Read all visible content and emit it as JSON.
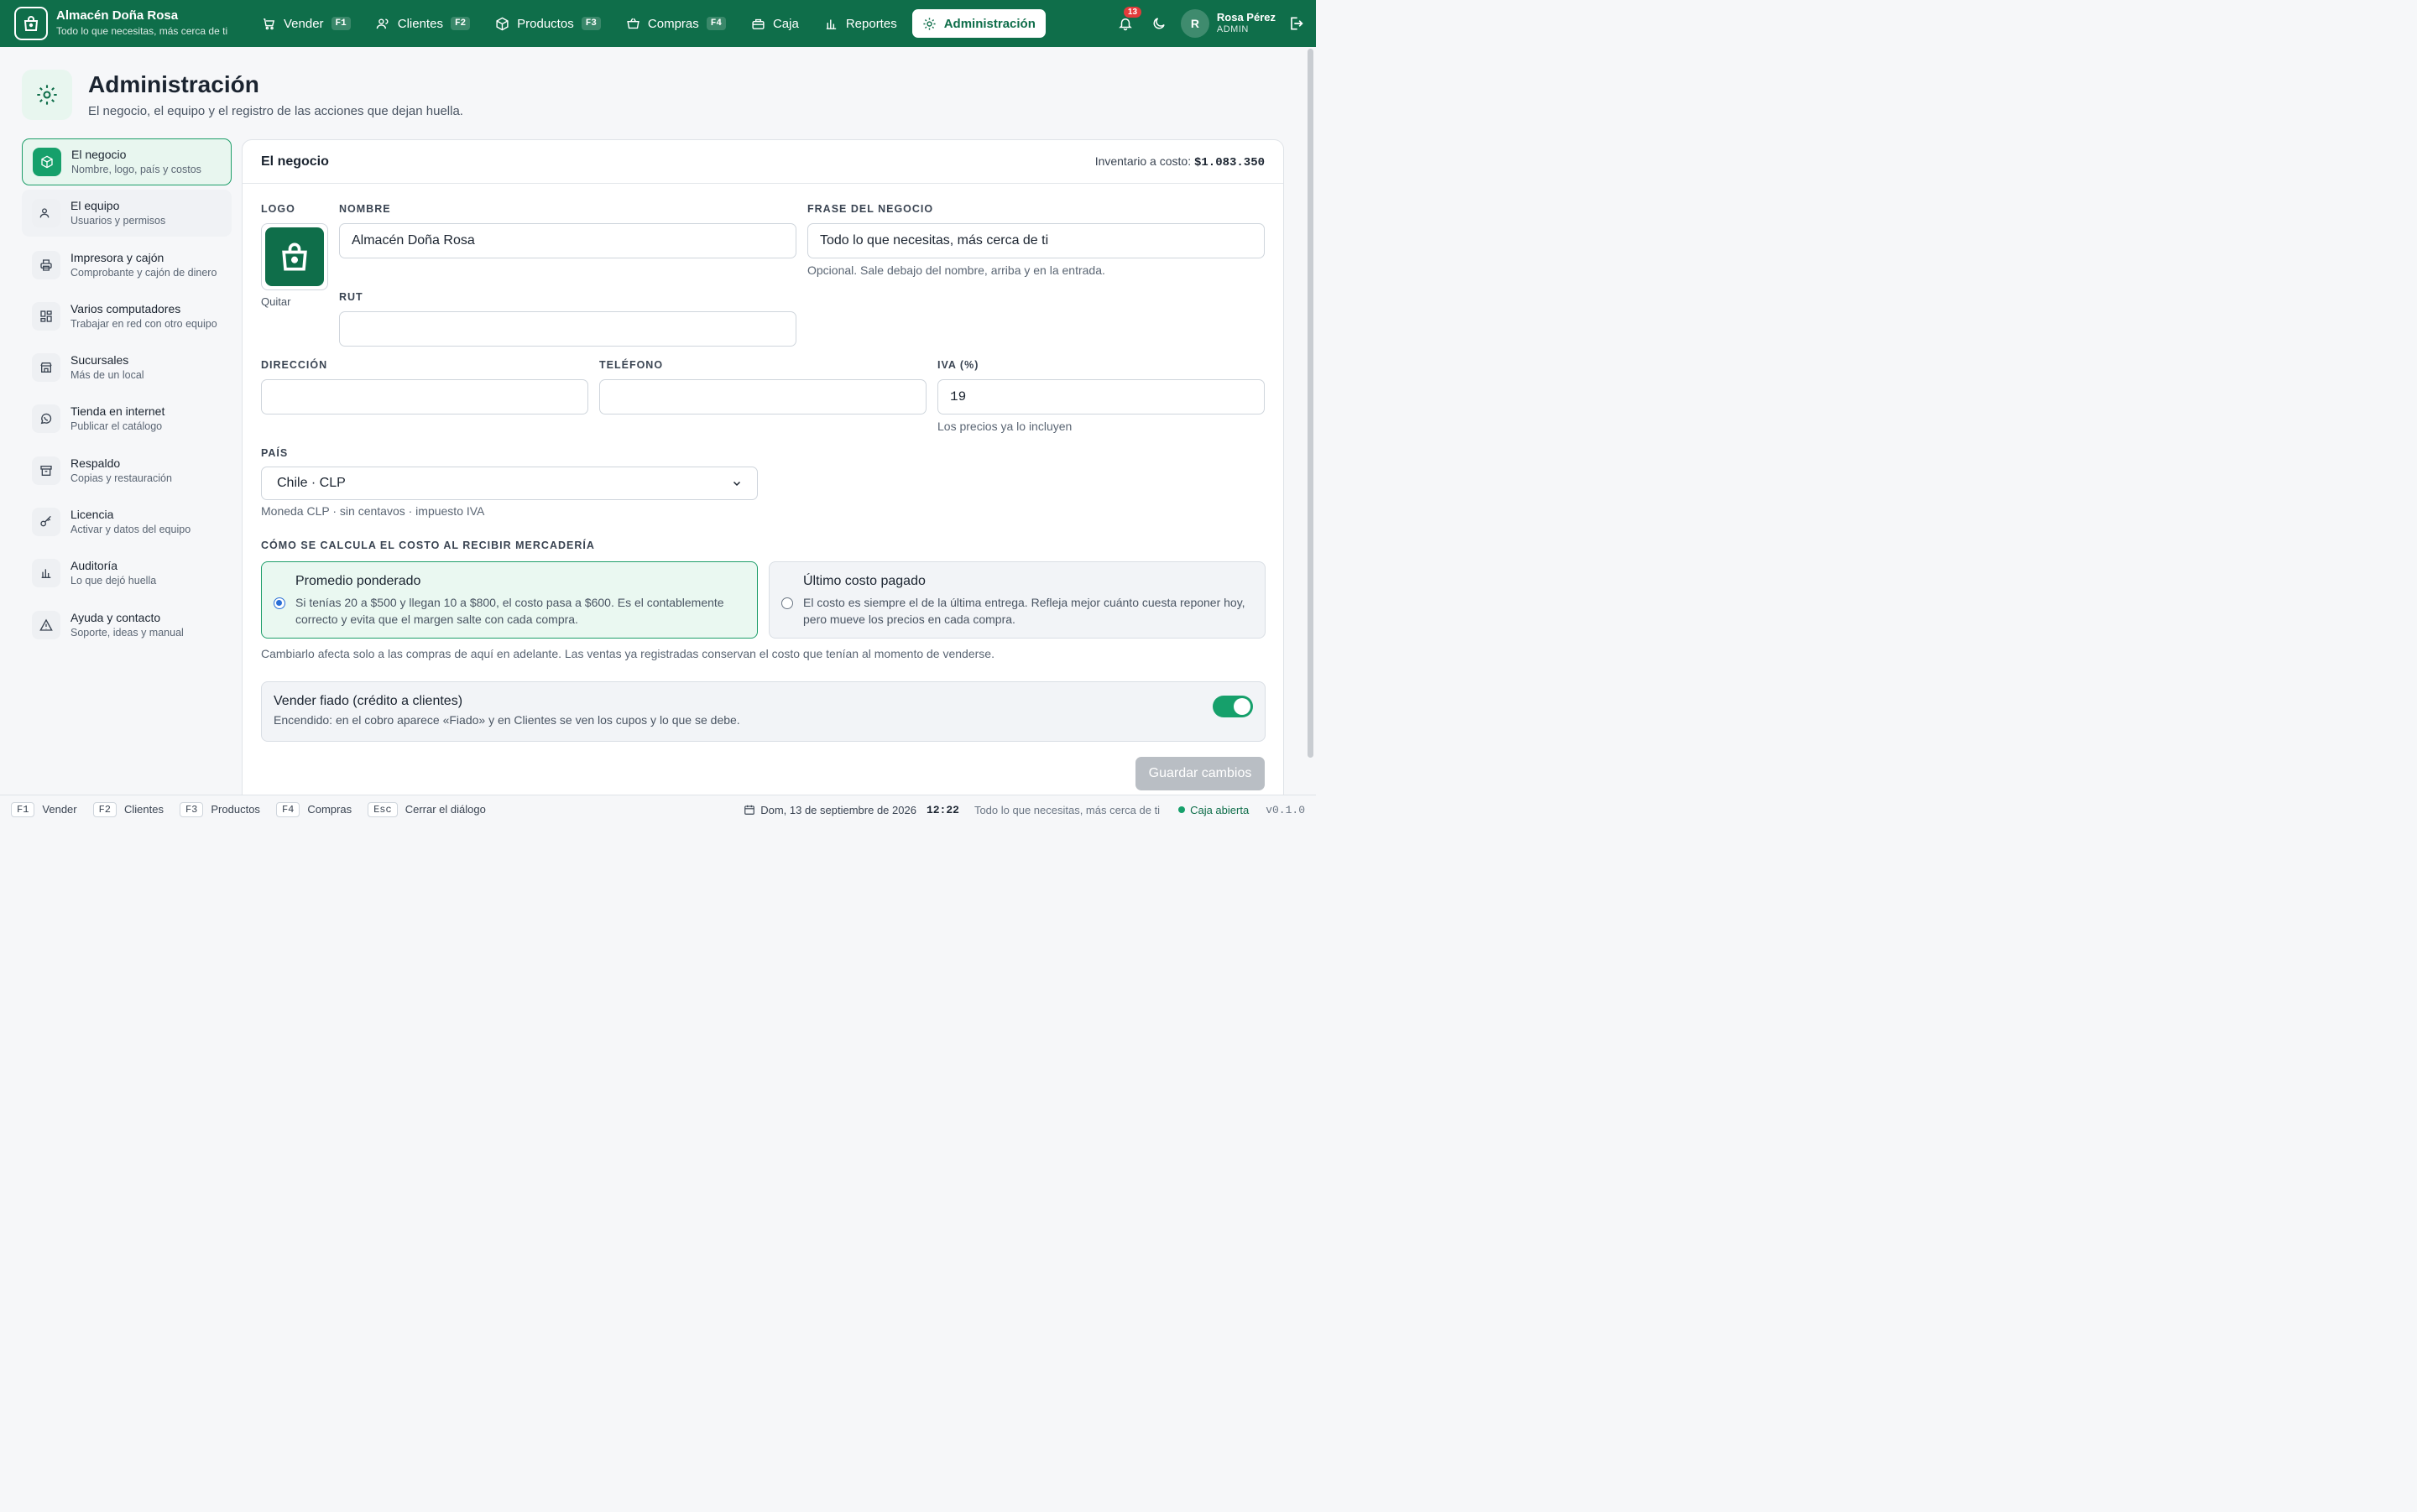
{
  "app": {
    "name": "Almacén Doña Rosa",
    "tagline": "Todo lo que necesitas, más cerca de ti"
  },
  "nav": [
    {
      "label": "Vender",
      "key": "F1",
      "icon": "cart-icon"
    },
    {
      "label": "Clientes",
      "key": "F2",
      "icon": "users-icon"
    },
    {
      "label": "Productos",
      "key": "F3",
      "icon": "box-icon"
    },
    {
      "label": "Compras",
      "key": "F4",
      "icon": "basket-icon"
    },
    {
      "label": "Caja",
      "key": "",
      "icon": "register-icon"
    },
    {
      "label": "Reportes",
      "key": "",
      "icon": "bar-chart-icon"
    },
    {
      "label": "Administración",
      "key": "",
      "icon": "gear-icon"
    }
  ],
  "user": {
    "notifications": "13",
    "initial": "R",
    "name": "Rosa Pérez",
    "role": "ADMIN"
  },
  "page": {
    "title": "Administración",
    "subtitle": "El negocio, el equipo y el registro de las acciones que dejan huella."
  },
  "sidebar": [
    {
      "title": "El negocio",
      "sub": "Nombre, logo, país y costos",
      "icon": "box-icon"
    },
    {
      "title": "El equipo",
      "sub": "Usuarios y permisos",
      "icon": "users-icon"
    },
    {
      "title": "Impresora y cajón",
      "sub": "Comprobante y cajón de dinero",
      "icon": "printer-icon"
    },
    {
      "title": "Varios computadores",
      "sub": "Trabajar en red con otro equipo",
      "icon": "grid-icon"
    },
    {
      "title": "Sucursales",
      "sub": "Más de un local",
      "icon": "store-icon"
    },
    {
      "title": "Tienda en internet",
      "sub": "Publicar el catálogo",
      "icon": "whatsapp-icon"
    },
    {
      "title": "Respaldo",
      "sub": "Copias y restauración",
      "icon": "archive-icon"
    },
    {
      "title": "Licencia",
      "sub": "Activar y datos del equipo",
      "icon": "key-icon"
    },
    {
      "title": "Auditoría",
      "sub": "Lo que dejó huella",
      "icon": "bar-chart-icon"
    },
    {
      "title": "Ayuda y contacto",
      "sub": "Soporte, ideas y manual",
      "icon": "warning-icon"
    }
  ],
  "card": {
    "title": "El negocio",
    "inventory_label": "Inventario a costo:",
    "inventory_value": "$1.083.350"
  },
  "form": {
    "logo_label": "LOGO",
    "logo_remove": "Quitar",
    "name_label": "NOMBRE",
    "name_value": "Almacén Doña Rosa",
    "phrase_label": "FRASE DEL NEGOCIO",
    "phrase_value": "Todo lo que necesitas, más cerca de ti",
    "phrase_hint": "Opcional. Sale debajo del nombre, arriba y en la entrada.",
    "rut_label": "RUT",
    "rut_value": "",
    "address_label": "DIRECCIÓN",
    "address_value": "",
    "phone_label": "TELÉFONO",
    "phone_value": "",
    "iva_label": "IVA (%)",
    "iva_value": "19",
    "iva_hint": "Los precios ya lo incluyen",
    "country_label": "PAÍS",
    "country_value": "Chile · CLP",
    "country_hint": "Moneda CLP · sin centavos · impuesto IVA",
    "cost_label": "CÓMO SE CALCULA EL COSTO AL RECIBIR MERCADERÍA",
    "cost_options": [
      {
        "title": "Promedio ponderado",
        "desc": "Si tenías 20 a $500 y llegan 10 a $800, el costo pasa a $600. Es el contablemente correcto y evita que el margen salte con cada compra.",
        "selected": true
      },
      {
        "title": "Último costo pagado",
        "desc": "El costo es siempre el de la última entrega. Refleja mejor cuánto cuesta reponer hoy, pero mueve los precios en cada compra.",
        "selected": false
      }
    ],
    "cost_note": "Cambiarlo afecta solo a las compras de aquí en adelante. Las ventas ya registradas conservan el costo que tenían al momento de venderse.",
    "fiado_title": "Vender fiado (crédito a clientes)",
    "fiado_desc": "Encendido: en el cobro aparece «Fiado» y en Clientes se ven los cupos y lo que se debe.",
    "fiado_on": true,
    "save_label": "Guardar cambios"
  },
  "footer": {
    "shortcuts": [
      {
        "key": "F1",
        "label": "Vender"
      },
      {
        "key": "F2",
        "label": "Clientes"
      },
      {
        "key": "F3",
        "label": "Productos"
      },
      {
        "key": "F4",
        "label": "Compras"
      },
      {
        "key": "Esc",
        "label": "Cerrar el diálogo"
      }
    ],
    "date": "Dom, 13 de septiembre de 2026",
    "time": "12:22",
    "tagline": "Todo lo que necesitas, más cerca de ti",
    "status": "Caja abierta",
    "version": "v0.1.0"
  },
  "colors": {
    "brand": "#0f6e4a",
    "accent": "#16a06b",
    "badge": "#e33b3b",
    "radio": "#2b6fd6"
  }
}
